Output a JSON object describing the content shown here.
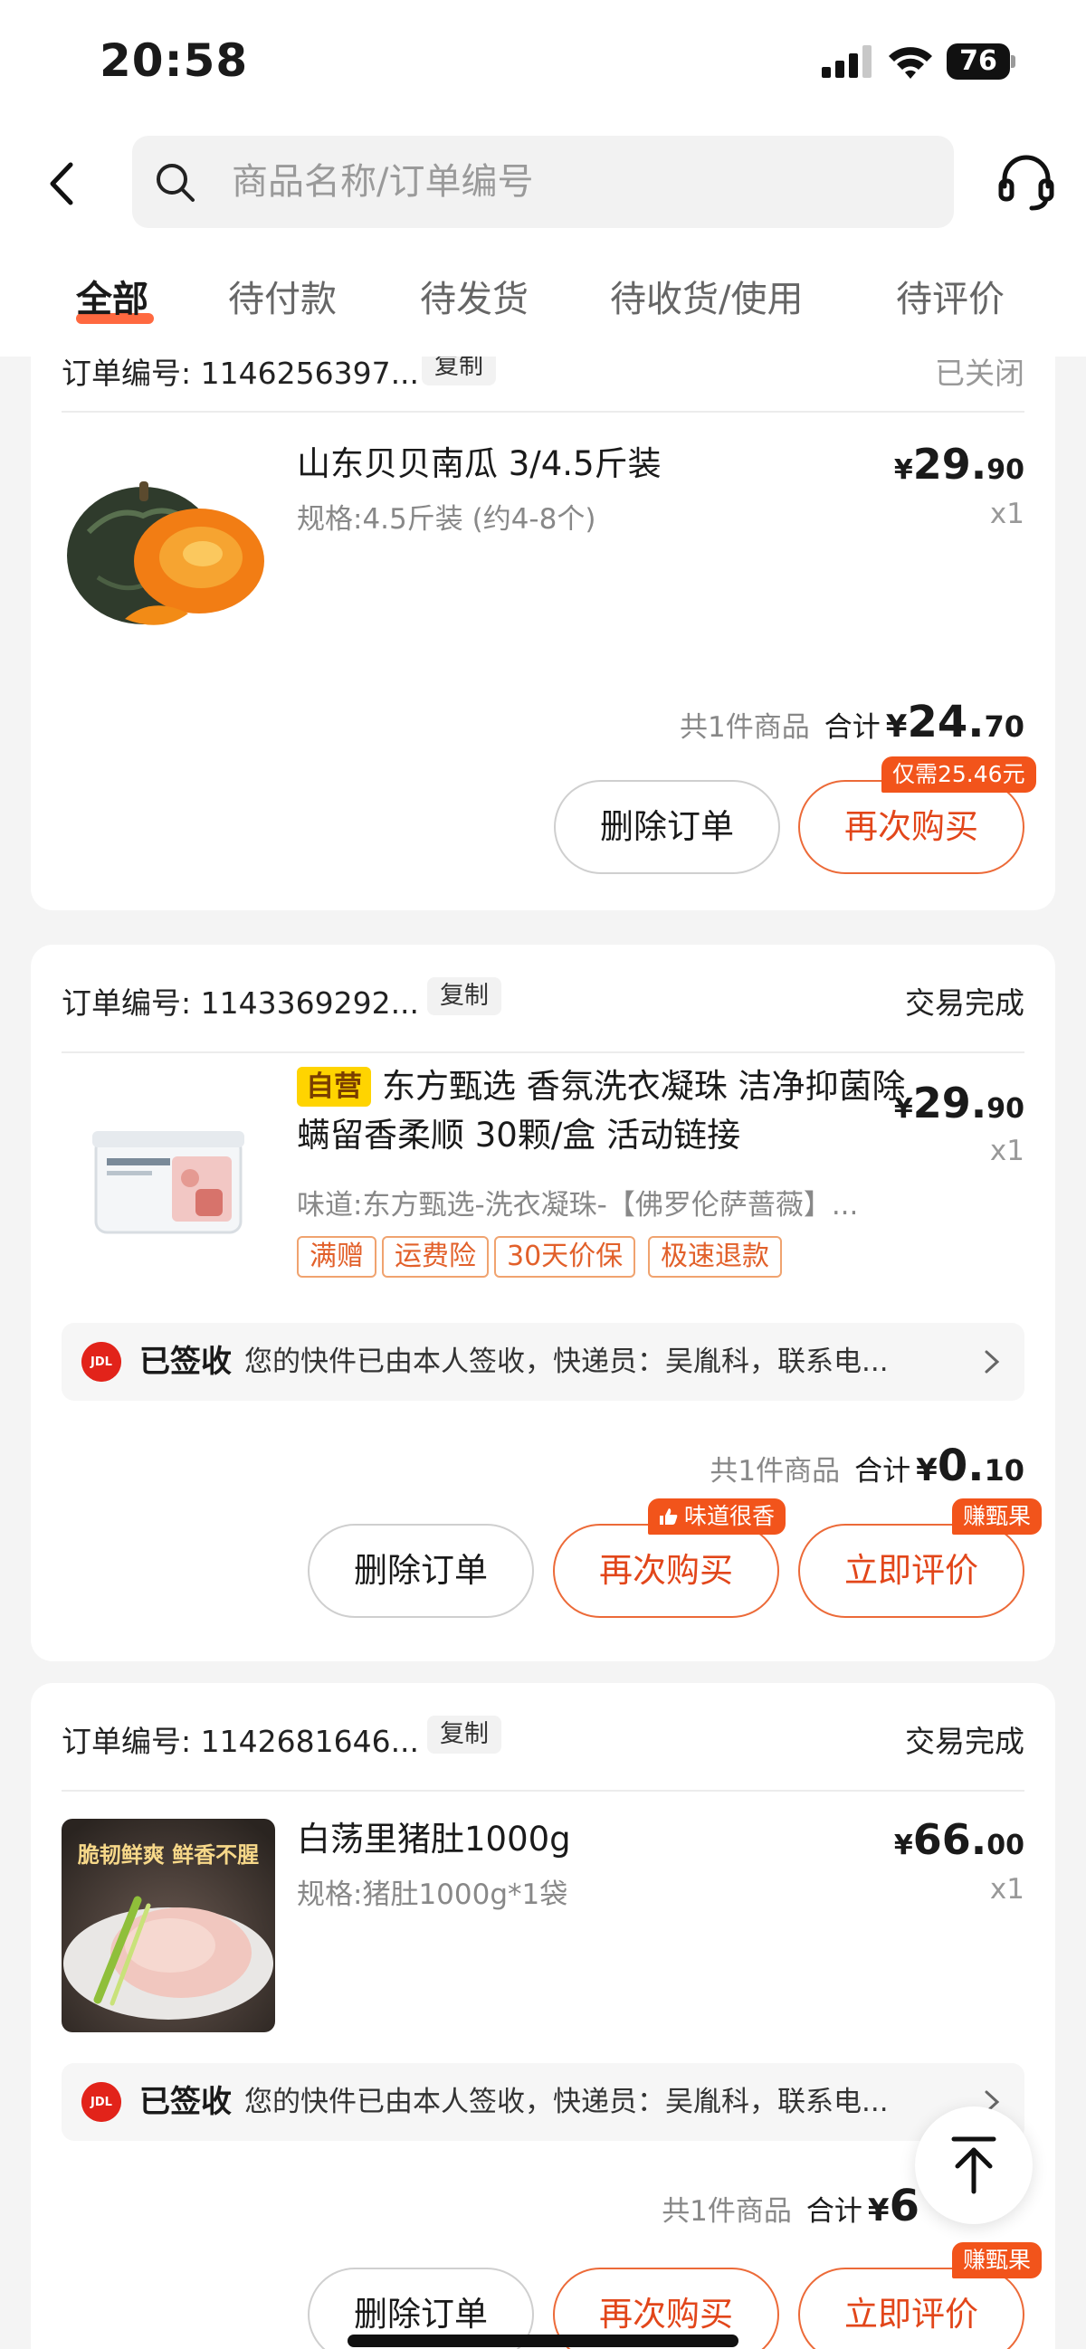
{
  "status_bar": {
    "time": "20:58",
    "battery": "76"
  },
  "header": {
    "search_placeholder": "商品名称/订单编号"
  },
  "tabs": [
    {
      "label": "全部",
      "active": true
    },
    {
      "label": "待付款"
    },
    {
      "label": "待发货"
    },
    {
      "label": "待收货/使用"
    },
    {
      "label": "待评价"
    }
  ],
  "orders": [
    {
      "order_no": "订单编号: 1146256397...",
      "copy_label": "复制",
      "status": "已关闭",
      "title": "山东贝贝南瓜 3/4.5斤装",
      "spec": "规格:4.5斤装 (约4-8个)",
      "price_cur": "¥",
      "price_int": "29.",
      "price_dec": "90",
      "qty": "x1",
      "count_text": "共1件商品",
      "total_label": "合计",
      "total_cur": "¥",
      "total_int": "24.",
      "total_dec": "70",
      "buttons": [
        {
          "label": "删除订单"
        },
        {
          "label": "再次购买",
          "badge": "仅需25.46元"
        }
      ]
    },
    {
      "order_no": "订单编号: 1143369292...",
      "copy_label": "复制",
      "status": "交易完成",
      "self_tag": "自营",
      "title": "东方甄选 香氛洗衣凝珠 洁净抑菌除螨留香柔顺 30颗/盒 活动链接",
      "spec": "味道:东方甄选-洗衣凝珠-【佛罗伦萨蔷薇】...",
      "tags": [
        "满赠",
        "运费险",
        "30天价保",
        "极速退款"
      ],
      "price_cur": "¥",
      "price_int": "29.",
      "price_dec": "90",
      "qty": "x1",
      "logistics_status": "已签收",
      "logistics_text": "您的快件已由本人签收，快递员：吴胤科，联系电...",
      "count_text": "共1件商品",
      "total_label": "合计",
      "total_cur": "¥",
      "total_int": "0.",
      "total_dec": "10",
      "buttons": [
        {
          "label": "删除订单"
        },
        {
          "label": "再次购买",
          "badge": "味道很香"
        },
        {
          "label": "立即评价",
          "badge": "赚甄果"
        }
      ]
    },
    {
      "order_no": "订单编号: 1142681646...",
      "copy_label": "复制",
      "status": "交易完成",
      "title": "白荡里猪肚1000g",
      "spec": "规格:猪肚1000g*1袋",
      "image_caption": "脆韧鲜爽 鲜香不腥",
      "price_cur": "¥",
      "price_int": "66.",
      "price_dec": "00",
      "qty": "x1",
      "logistics_status": "已签收",
      "logistics_text": "您的快件已由本人签收，快递员：吴胤科，联系电...",
      "count_text": "共1件商品",
      "total_label": "合计",
      "total_cur": "¥",
      "total_int": "6",
      "total_dec": "",
      "buttons": [
        {
          "label": "删除订单"
        },
        {
          "label": "再次购买"
        },
        {
          "label": "立即评价",
          "badge": "赚甄果"
        }
      ]
    }
  ],
  "colors": {
    "accent": "#e2461a",
    "badge": "#f2541b",
    "self_tag": "#ffd400"
  },
  "icons": [
    "back-arrow-icon",
    "search-icon",
    "customer-service-icon",
    "jd-logistics-icon",
    "chevron-right-icon",
    "back-to-top-icon",
    "thumbs-up-icon"
  ]
}
